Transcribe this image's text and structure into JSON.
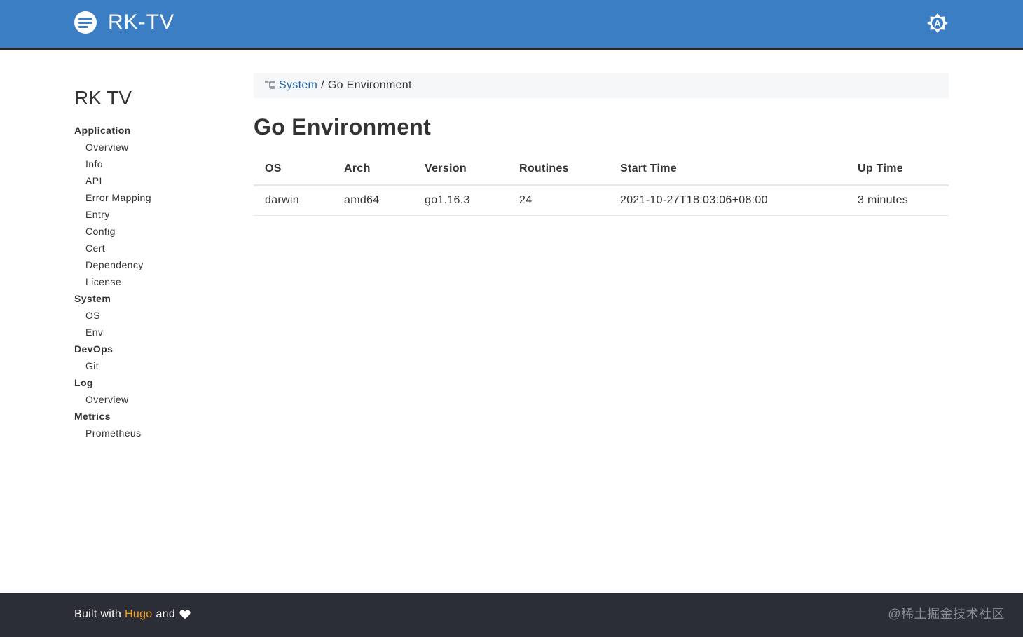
{
  "header": {
    "site_name": "RK-TV",
    "theme_toggle_letter": "A"
  },
  "sidebar": {
    "title": "RK TV",
    "sections": [
      {
        "label": "Application",
        "items": [
          "Overview",
          "Info",
          "API",
          "Error Mapping",
          "Entry",
          "Config",
          "Cert",
          "Dependency",
          "License"
        ]
      },
      {
        "label": "System",
        "items": [
          "OS",
          "Env"
        ]
      },
      {
        "label": "DevOps",
        "items": [
          "Git"
        ]
      },
      {
        "label": "Log",
        "items": [
          "Overview"
        ]
      },
      {
        "label": "Metrics",
        "items": [
          "Prometheus"
        ]
      }
    ]
  },
  "breadcrumb": {
    "parent": "System",
    "separator": "/",
    "current": "Go Environment"
  },
  "main": {
    "title": "Go Environment",
    "table": {
      "columns": [
        "OS",
        "Arch",
        "Version",
        "Routines",
        "Start Time",
        "Up Time"
      ],
      "rows": [
        [
          "darwin",
          "amd64",
          "go1.16.3",
          "24",
          "2021-10-27T18:03:06+08:00",
          "3 minutes"
        ]
      ]
    }
  },
  "footer": {
    "built_with": "Built with",
    "hugo_link": "Hugo",
    "and": "and",
    "watermark": "@稀土掘金技术社区"
  },
  "colors": {
    "header_bg": "#3c7ec4",
    "footer_bg": "#2b2d37",
    "link": "#1e64a8",
    "hugo_link": "#f4a224"
  }
}
